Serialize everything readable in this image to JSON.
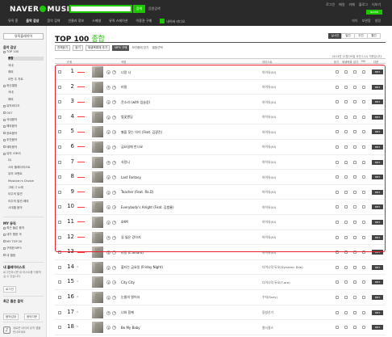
{
  "header": {
    "logo_text": "NAVER",
    "logo_suffix": "MUSIC",
    "search_button": "검색",
    "search_extra": "음원검색",
    "util_links": [
      "로그인",
      "메일",
      "카페",
      "블로그",
      "더보기"
    ],
    "naver_badge": "NAVER",
    "gnb": [
      {
        "label": "뮤직 홈",
        "active": false
      },
      {
        "label": "음악 감상",
        "active": true
      },
      {
        "label": "음악 검색",
        "active": false
      },
      {
        "label": "인물과 정보",
        "active": false
      },
      {
        "label": "스페셜",
        "active": false
      },
      {
        "label": "뮤직 스테이션",
        "active": false
      },
      {
        "label": "이용권 구매",
        "active": false
      },
      {
        "label": "네이버 라디오",
        "active": false
      }
    ],
    "gnb_right": [
      "마이",
      "보관함",
      "설정"
    ]
  },
  "sidebar": {
    "player_button": "뮤직플레이어",
    "sections": {
      "listen": "음악 감상",
      "my": "MY 뮤직",
      "playlist": "내 플레이리스트",
      "recent": "최근 들은 음악"
    },
    "items": [
      {
        "label": "TOP 100",
        "level": 0
      },
      {
        "label": "종합",
        "level": 1,
        "selected": true
      },
      {
        "label": "국내",
        "level": 1
      },
      {
        "label": "해외",
        "level": 1
      },
      {
        "label": "이번 주 차트",
        "level": 1
      },
      {
        "label": "최신앨범",
        "level": 0
      },
      {
        "label": "국내",
        "level": 1
      },
      {
        "label": "해외",
        "level": 1
      },
      {
        "label": "뮤직비디오",
        "level": 0
      },
      {
        "label": "OST",
        "level": 0
      },
      {
        "label": "국내음악",
        "level": 0
      },
      {
        "label": "해외음악",
        "level": 0
      },
      {
        "label": "장르음악",
        "level": 0
      },
      {
        "label": "추천음악",
        "level": 0
      },
      {
        "label": "테마음악",
        "level": 0
      },
      {
        "label": "뮤직 스토리",
        "level": 0
      },
      {
        "label": "DJ",
        "level": 1
      },
      {
        "label": "스타 플레이리스트",
        "level": 1
      },
      {
        "label": "뮤직 코멘트",
        "level": 1
      },
      {
        "label": "Musician's Choice",
        "level": 1
      },
      {
        "label": "그때 그 노래",
        "level": 1
      },
      {
        "label": "이주의 발견",
        "level": 1
      },
      {
        "label": "이주의 발견-해외",
        "level": 1
      },
      {
        "label": "시대별 음악",
        "level": 1
      }
    ],
    "my_items": [
      "최근 들은 음악",
      "내가 찜한 곡",
      "MY TOP 20",
      "구매한 MP3",
      "내 앨범"
    ],
    "login_note": "로그인하시면 내 리스트를 이용하실 수 있습니다.",
    "login_btn": "로그인",
    "bottom_btns": [
      "음악감상",
      "음악다운"
    ],
    "app_promo": "세로운 네이버 뮤직 앱을 만나보세요"
  },
  "main": {
    "title": "TOP 100",
    "title_sub": "종합",
    "tabs": [
      {
        "label": "실시간",
        "active": true
      },
      {
        "label": "일간",
        "active": false
      },
      {
        "label": "주간",
        "active": false
      },
      {
        "label": "월간",
        "active": false
      }
    ],
    "toolbar": {
      "play_selected": "전체듣기",
      "play": "듣기",
      "add_list": "재생목록에 추가",
      "mp3_buy": "MP3 구매",
      "links": [
        "보관함에 담기",
        "앨범선택"
      ]
    },
    "table_meta": "2013년 11월 29일 오전 11시 기준입니다.",
    "columns": [
      "순위",
      "곡명",
      "아티스트",
      "듣기",
      "재생목록",
      "담기",
      "MV",
      "다운"
    ],
    "rows": [
      {
        "rank": 1,
        "change": "-",
        "song": "너랑 나",
        "artist": "아이유(IU)"
      },
      {
        "rank": 2,
        "change": "-",
        "song": "비밀",
        "artist": "아이유(IU)"
      },
      {
        "rank": 3,
        "change": "-",
        "song": "잔소리 (with 임슬옹)",
        "artist": "아이유(IU)"
      },
      {
        "rank": 4,
        "change": "-",
        "song": "벚꽃엔딩",
        "artist": "아이유(IU)"
      },
      {
        "rank": 5,
        "change": "-",
        "song": "별을 찾는 아이 (Feat. 김광진)",
        "artist": "아이유(IU)"
      },
      {
        "rank": 6,
        "change": "-",
        "song": "금요일에 만나요",
        "artist": "아이유(IU)"
      },
      {
        "rank": 7,
        "change": "-",
        "song": "사랑니",
        "artist": "아이유(IU)"
      },
      {
        "rank": 8,
        "change": "-",
        "song": "Last Fantasy",
        "artist": "아이유(IU)"
      },
      {
        "rank": 9,
        "change": "-",
        "song": "Teacher (Feat. Ra.D)",
        "artist": "아이유(IU)"
      },
      {
        "rank": 10,
        "change": "-",
        "song": "Everybody's Alright (Feat. 김범룡)",
        "artist": "아이유(IU)"
      },
      {
        "rank": 11,
        "change": "-",
        "song": "4AM",
        "artist": "아이유(IU)"
      },
      {
        "rank": 12,
        "change": "-",
        "song": "길 잃은 강아지",
        "artist": "아이유(IU)"
      },
      {
        "rank": 13,
        "change": "-",
        "song": "라망 (L'amant)",
        "artist": "아이유(IU)"
      },
      {
        "rank": 14,
        "change": "4",
        "song": "불타는 금요일 (Friday Night)",
        "artist": "다이나믹 듀오(Dynamic Duo)"
      },
      {
        "rank": 15,
        "change": "4",
        "song": "City City",
        "artist": "다이나믹 듀오(T-ara)"
      },
      {
        "rank": 16,
        "change": "4",
        "song": "눈물의 멀어서",
        "artist": "수지(Suzy)"
      },
      {
        "rank": 17,
        "change": "6",
        "song": "너와 함께",
        "artist": "동방신기"
      },
      {
        "rank": 18,
        "change": "6",
        "song": "Be My Baby",
        "artist": "원더걸스"
      },
      {
        "rank": 19,
        "change": "4",
        "song": "작전하고 나갈게 (Lost Star)",
        "artist": "다이나믹 듀오(Dynamic Duo)"
      }
    ],
    "mp3_label": "MP3"
  },
  "colors": {
    "brand_green": "#1ec800",
    "highlight_red": "#e61e2e",
    "header_bg": "#2a2a2a"
  }
}
